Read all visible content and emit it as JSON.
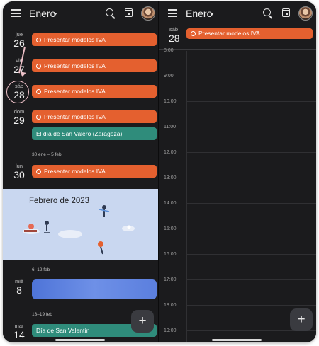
{
  "left_panel": {
    "header": {
      "month_label": "Enero"
    },
    "days": [
      {
        "day_name": "jue",
        "day_num": "26"
      },
      {
        "day_name": "vie",
        "day_num": "27"
      },
      {
        "day_name": "sáb",
        "day_num": "28"
      },
      {
        "day_name": "dom",
        "day_num": "29"
      },
      {
        "day_name": "lun",
        "day_num": "30"
      },
      {
        "day_name": "mié",
        "day_num": "8"
      },
      {
        "day_name": "mar",
        "day_num": "14"
      }
    ],
    "events": [
      {
        "title": "Presentar modelos IVA",
        "color": "#e4602f"
      },
      {
        "title": "Presentar modelos IVA",
        "color": "#e4602f"
      },
      {
        "title": "Presentar modelos IVA",
        "color": "#e4602f"
      },
      {
        "title": "Presentar modelos IVA",
        "color": "#e4602f"
      },
      {
        "title": "El día de San Valero (Zaragoza)",
        "color": "#2f8c7b"
      },
      {
        "title": "Presentar modelos IVA",
        "color": "#e4602f"
      },
      {
        "title": "Día de San Valentín",
        "color": "#2f8c7b"
      }
    ],
    "week_labels": [
      "30 ene – 5 feb",
      "6–12 feb",
      "13–19 feb"
    ],
    "banner_title": "Febrero de 2023",
    "fab_label": "+"
  },
  "right_panel": {
    "header": {
      "month_label": "Enero"
    },
    "day_name": "sáb",
    "day_num": "28",
    "allday_event": "Presentar modelos IVA",
    "hours": [
      "8:00",
      "9:00",
      "10:00",
      "11:00",
      "12:00",
      "13:00",
      "14:00",
      "15:00",
      "16:00",
      "17:00",
      "18:00",
      "19:00"
    ],
    "fab_label": "+"
  },
  "colors": {
    "background": "#1b1b1d",
    "event_orange": "#e4602f",
    "event_teal": "#2f8c7b",
    "annotation_pink": "#ecc0c7"
  },
  "icons": [
    "menu-icon",
    "caret-down-icon",
    "search-icon",
    "calendar-today-icon",
    "avatar",
    "check-circle-icon",
    "add-icon"
  ]
}
